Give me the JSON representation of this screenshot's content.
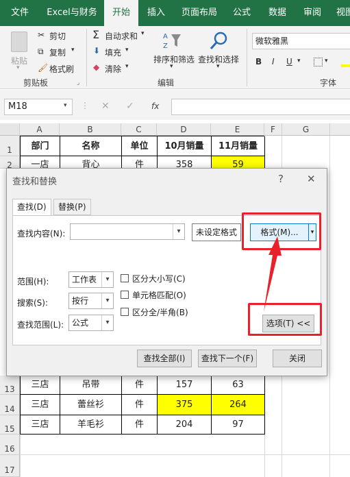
{
  "ribbon_tabs": [
    "文件",
    "Excel与财务",
    "开始",
    "插入",
    "页面布局",
    "公式",
    "数据",
    "审阅",
    "视图"
  ],
  "clipboard": {
    "paste": "粘贴",
    "cut": "剪切",
    "copy": "复制",
    "format_painter": "格式刷",
    "group": "剪贴板"
  },
  "editing": {
    "autosum": "自动求和",
    "fill": "填充",
    "clear": "清除",
    "sort_filter": "排序和筛选",
    "find_select": "查找和选择",
    "group": "编辑"
  },
  "font": {
    "name": "微软雅黑",
    "group": "字体",
    "bold": "B",
    "italic": "I",
    "underline": "U"
  },
  "formula_bar": {
    "name_box": "M18",
    "fx": "fx"
  },
  "columns": [
    "A",
    "B",
    "C",
    "D",
    "E",
    "F",
    "G"
  ],
  "rows_visible": [
    "1",
    "2",
    "13",
    "14",
    "15",
    "16",
    "17"
  ],
  "table": {
    "header": [
      "部门",
      "名称",
      "单位",
      "10月销量",
      "11月销量"
    ],
    "row2": [
      "一店",
      "背心",
      "件",
      "358",
      "59"
    ],
    "row13": [
      "三店",
      "吊带",
      "件",
      "157",
      "63"
    ],
    "row14": [
      "三店",
      "蕾丝衫",
      "件",
      "375",
      "264"
    ],
    "row15": [
      "三店",
      "羊毛衫",
      "件",
      "204",
      "97"
    ]
  },
  "dialog": {
    "title": "查找和替换",
    "help": "?",
    "close_icon": "✕",
    "tab_find": "查找(D)",
    "tab_replace": "替换(P)",
    "find_label": "查找内容(N):",
    "find_value": "",
    "no_format": "未设定格式",
    "format_button": "格式(M)...",
    "scope_label": "范围(H):",
    "scope_value": "工作表",
    "search_label": "搜索(S):",
    "search_value": "按行",
    "lookin_label": "查找范围(L):",
    "lookin_value": "公式",
    "match_case": "区分大小写(C)",
    "match_cell": "单元格匹配(O)",
    "match_width": "区分全/半角(B)",
    "options_button": "选项(T) <<",
    "find_all": "查找全部(I)",
    "find_next": "查找下一个(F)",
    "close_button": "关闭"
  },
  "colors": {
    "excel_green": "#217346",
    "highlight": "#ffff00",
    "annotation_red": "#e8212b"
  }
}
